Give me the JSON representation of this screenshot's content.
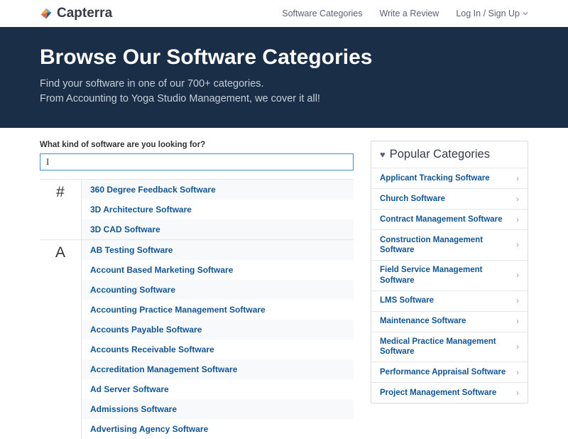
{
  "brand": "Capterra",
  "nav": {
    "categories": "Software Categories",
    "review": "Write a Review",
    "login": "Log In / Sign Up"
  },
  "hero": {
    "title": "Browse Our Software Categories",
    "line1": "Find your software in one of our 700+ categories.",
    "line2": "From Accounting to Yoga Studio Management, we cover it all!"
  },
  "search": {
    "label": "What kind of software are you looking for?"
  },
  "index": [
    {
      "letter": "#",
      "items": [
        "360 Degree Feedback Software",
        "3D Architecture Software",
        "3D CAD Software"
      ]
    },
    {
      "letter": "A",
      "items": [
        "AB Testing Software",
        "Account Based Marketing Software",
        "Accounting Software",
        "Accounting Practice Management Software",
        "Accounts Payable Software",
        "Accounts Receivable Software",
        "Accreditation Management Software",
        "Ad Server Software",
        "Admissions Software",
        "Advertising Agency Software"
      ]
    }
  ],
  "popular": {
    "title": "Popular Categories",
    "items": [
      "Applicant Tracking Software",
      "Church Software",
      "Contract Management Software",
      "Construction Management Software",
      "Field Service Management Software",
      "LMS Software",
      "Maintenance Software",
      "Medical Practice Management Software",
      "Performance Appraisal Software",
      "Project Management Software"
    ]
  }
}
